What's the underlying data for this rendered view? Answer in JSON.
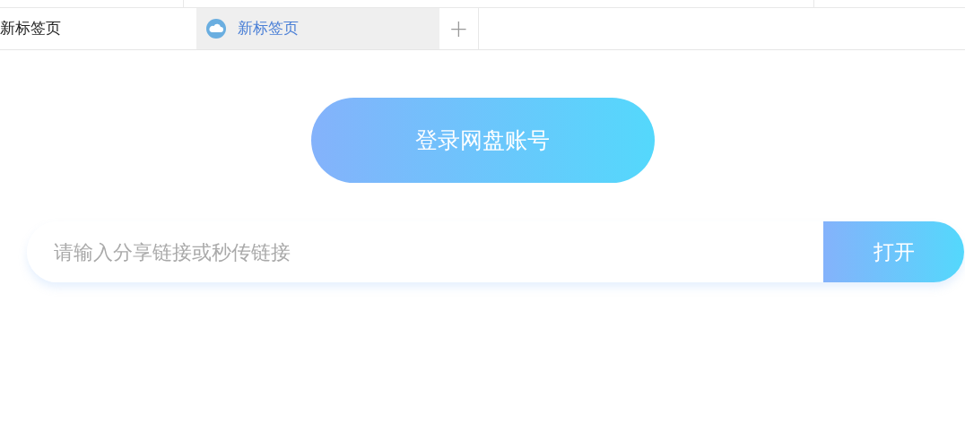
{
  "tabs": [
    {
      "label": "新标签页",
      "selected": false,
      "icon": false
    },
    {
      "label": "新标签页",
      "selected": true,
      "icon": true
    }
  ],
  "new_tab_button": "+",
  "login_button": "登录网盘账号",
  "link_search": {
    "placeholder": "请输入分享链接或秒传链接",
    "button": "打开"
  }
}
